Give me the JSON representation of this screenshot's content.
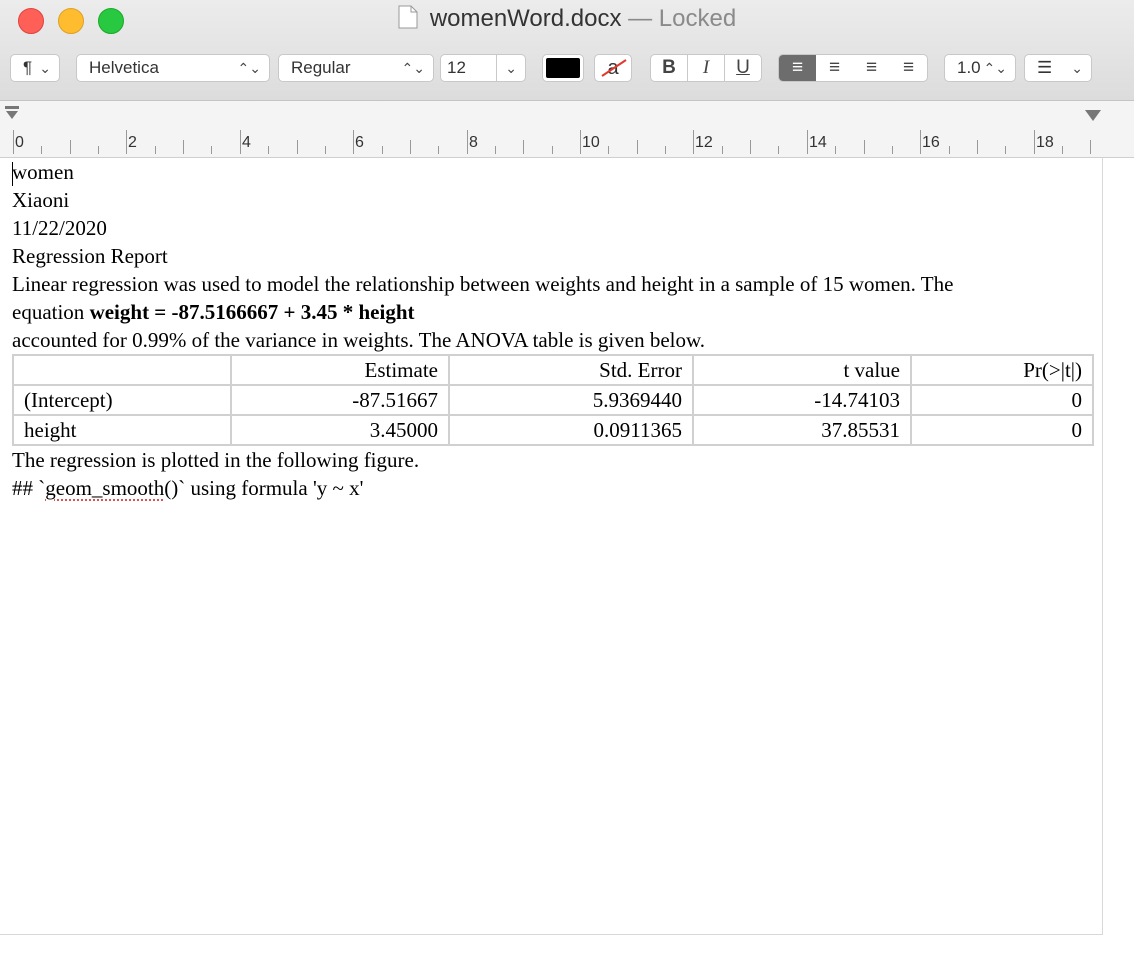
{
  "window": {
    "title": "womenWord.docx",
    "separator": "—",
    "status": "Locked"
  },
  "toolbar": {
    "paragraph_style": "¶",
    "font_family": "Helvetica",
    "font_style": "Regular",
    "font_size": "12",
    "text_color": "#000000",
    "highlight_glyph": "a",
    "bold": "B",
    "italic": "I",
    "underline": "U",
    "line_spacing": "1.0"
  },
  "ruler": {
    "labels": [
      "0",
      "2",
      "4",
      "6",
      "8",
      "10",
      "12",
      "14",
      "16",
      "18"
    ]
  },
  "document": {
    "lines": [
      "women",
      "Xiaoni",
      "11/22/2020",
      "Regression Report"
    ],
    "para1_line1": "Linear regression was used to model the relationship between weights and height in a sample of 15 women. The",
    "para1_line2_prefix": "equation ",
    "para1_line2_bold": "weight = -87.5166667 + 3.45 * height",
    "para1_line3": "accounted for 0.99% of the variance in weights. The ANOVA table is given below.",
    "table": {
      "headers": [
        "",
        "Estimate",
        "Std. Error",
        "t value",
        "Pr(>|t|)"
      ],
      "rows": [
        [
          "(Intercept)",
          "-87.51667",
          "5.9369440",
          "-14.74103",
          "0"
        ],
        [
          "height",
          "3.45000",
          "0.0911365",
          "37.85531",
          "0"
        ]
      ]
    },
    "after1": "The regression is plotted in the following figure.",
    "after2_prefix": "## `",
    "after2_squiggle": "geom_smooth",
    "after2_suffix": "()` using formula 'y ~ x'"
  }
}
